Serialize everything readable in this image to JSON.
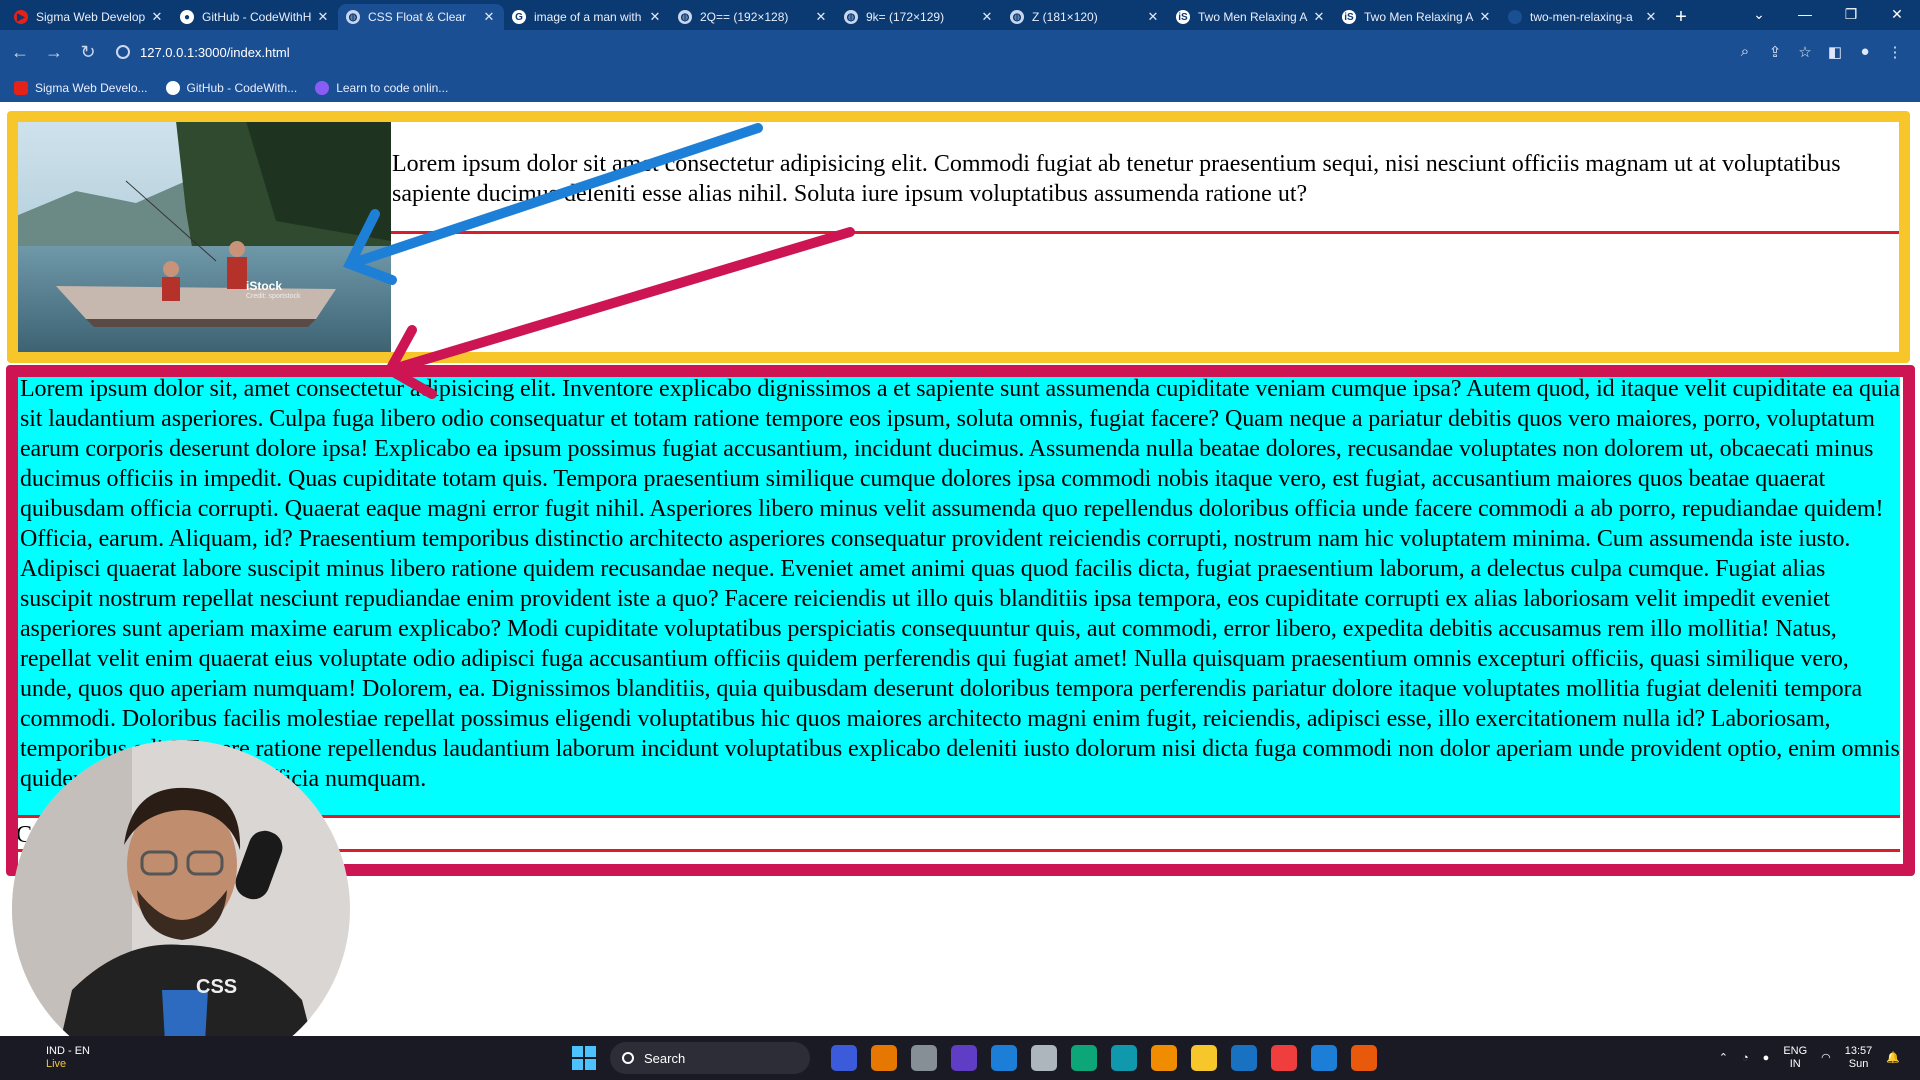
{
  "tabs": [
    {
      "title": "Sigma Web Develop",
      "favicon_color": "#e62117",
      "favicon": "▶",
      "active": false
    },
    {
      "title": "GitHub - CodeWithH",
      "favicon_color": "#ffffff",
      "favicon": "●",
      "active": false
    },
    {
      "title": "CSS Float & Clear",
      "favicon_color": "#c9d6ee",
      "favicon": "◍",
      "active": true
    },
    {
      "title": "image of a man with",
      "favicon_color": "#ffffff",
      "favicon": "G",
      "active": false
    },
    {
      "title": "2Q== (192×128)",
      "favicon_color": "#c9d6ee",
      "favicon": "◍",
      "active": false
    },
    {
      "title": "9k= (172×129)",
      "favicon_color": "#c9d6ee",
      "favicon": "◍",
      "active": false
    },
    {
      "title": "Z (181×120)",
      "favicon_color": "#c9d6ee",
      "favicon": "◍",
      "active": false
    },
    {
      "title": "Two Men Relaxing A",
      "favicon_color": "#ffffff",
      "favicon": "iS",
      "active": false
    },
    {
      "title": "Two Men Relaxing A",
      "favicon_color": "#ffffff",
      "favicon": "iS",
      "active": false
    },
    {
      "title": "two-men-relaxing-a",
      "favicon_color": "#1b4f93",
      "favicon": "",
      "active": false
    }
  ],
  "address": {
    "url": "127.0.0.1:3000/index.html"
  },
  "bookmarks": [
    {
      "label": "Sigma Web Develo...",
      "color": "#e62117"
    },
    {
      "label": "GitHub - CodeWith...",
      "color": "#ffffff"
    },
    {
      "label": "Learn to code onlin...",
      "color": "#8a5cf6"
    }
  ],
  "page": {
    "box1_text": "Lorem ipsum dolor sit amet consectetur adipisicing elit. Commodi fugiat ab tenetur praesentium sequi, nisi nesciunt officiis magnam ut at voluptatibus sapiente ducimus deleniti esse alias nihil. Soluta iure ipsum voluptatibus assumenda ratione ut?",
    "box2_text": "Lorem ipsum dolor sit, amet consectetur adipisicing elit. Inventore explicabo dignissimos a et sapiente sunt assumenda cupiditate veniam cumque ipsa? Autem quod, id itaque velit cupiditate ea quia sit laudantium asperiores. Culpa fuga libero odio consequatur et totam ratione tempore eos ipsum, soluta omnis, fugiat facere? Quam neque a pariatur debitis quos vero maiores, porro, voluptatum earum corporis deserunt dolore ipsa! Explicabo ea ipsum possimus fugiat accusantium, incidunt ducimus. Assumenda nulla beatae dolores, recusandae voluptates non dolorem ut, obcaecati minus ducimus officiis in impedit. Quas cupiditate totam quis. Tempora praesentium similique cumque dolores ipsa commodi nobis itaque vero, est fugiat, accusantium maiores quos beatae quaerat quibusdam officia corrupti. Quaerat eaque magni error fugit nihil. Asperiores libero minus velit assumenda quo repellendus doloribus officia unde facere commodi a ab porro, repudiandae quidem! Officia, earum. Aliquam, id? Praesentium temporibus distinctio architecto asperiores consequatur provident reiciendis corrupti, nostrum nam hic voluptatem minima. Cum assumenda iste iusto. Adipisci quaerat labore suscipit minus libero ratione quidem recusandae neque. Eveniet amet animi quas quod facilis dicta, fugiat praesentium laborum, a delectus culpa cumque. Fugiat alias suscipit nostrum repellat nesciunt repudiandae enim provident iste a quo? Facere reiciendis ut illo quis blanditiis ipsa tempora, eos cupiditate corrupti ex alias laboriosam velit impedit eveniet asperiores sunt aperiam maxime earum explicabo? Modi cupiditate voluptatibus perspiciatis consequuntur quis, aut commodi, error libero, expedita debitis accusamus rem illo mollitia! Natus, repellat velit enim quaerat eius voluptate odio adipisci fuga accusantium officiis quidem perferendis qui fugiat amet! Nulla quisquam praesentium omnis excepturi officiis, quasi similique vero, unde, quos quo aperiam numquam! Dolorem, ea. Dignissimos blanditiis, quia quibusdam deserunt doloribus tempora perferendis pariatur dolore itaque voluptates mollitia fugiat deleniti tempora commodi. Doloribus facilis molestiae repellat possimus eligendi voluptatibus hic quos maiores architecto magni enim fugit, reiciendis, adipisci esse, illo exercitationem nulla id? Laboriosam, temporibus odit? Facere ratione repellendus laudantium laborum incidunt voluptatibus explicabo deleniti iusto dolorum nisi dicta fuga commodi non dolor aperiam unde provident optio, enim omnis quidem. Nulla molestias officia numquam.",
    "box3_text": "C",
    "image_watermark": "iStock",
    "image_credit": "Credit: sportstock",
    "colors": {
      "highlight_yellow": "#f6c62b",
      "highlight_pink": "#cc1552",
      "arrow_blue": "#1e7fd6",
      "cyan": "#00ffff",
      "red_border": "#d61f2a"
    }
  },
  "taskbar": {
    "weather": {
      "line1": "IND - EN",
      "line2": "Live"
    },
    "search_label": "Search",
    "icons": [
      "widgets-icon",
      "copilot-icon",
      "taskview-icon",
      "teams-icon",
      "calendar-icon",
      "settings-icon",
      "edge-icon",
      "skype-icon",
      "chrome-icon",
      "explorer-icon",
      "todo-icon",
      "chrome2-icon",
      "vscode-icon",
      "chrome3-icon"
    ],
    "tray": {
      "lang1": "ENG",
      "lang2": "IN",
      "time": "13:57",
      "day": "Sun"
    }
  },
  "webcam_shirt_text": "CSS"
}
